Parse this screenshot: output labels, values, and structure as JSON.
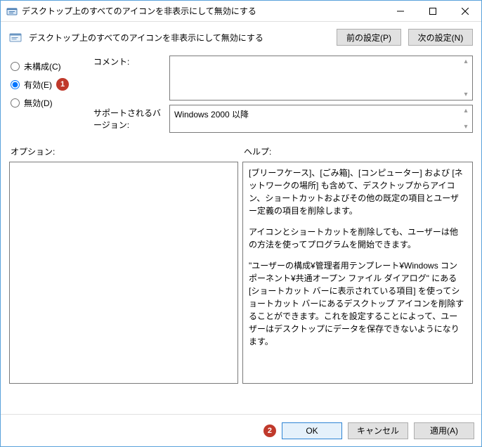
{
  "window": {
    "title": "デスクトップ上のすべてのアイコンを非表示にして無効にする"
  },
  "header": {
    "title": "デスクトップ上のすべてのアイコンを非表示にして無効にする",
    "prev_button": "前の設定(P)",
    "next_button": "次の設定(N)"
  },
  "radios": {
    "not_configured": "未構成(C)",
    "enabled": "有効(E)",
    "disabled": "無効(D)",
    "selected": "enabled"
  },
  "labels": {
    "comment": "コメント:",
    "supported": "サポートされるバージョン:",
    "options": "オプション:",
    "help": "ヘルプ:"
  },
  "fields": {
    "comment_text": "",
    "supported_text": "Windows 2000 以降"
  },
  "help_paragraphs": [
    "[ブリーフケース]、[ごみ箱]、[コンピューター] および [ネットワークの場所] も含めて、デスクトップからアイコン、ショートカットおよびその他の既定の項目とユーザー定義の項目を削除します。",
    "アイコンとショートカットを削除しても、ユーザーは他の方法を使ってプログラムを開始できます。",
    "\"ユーザーの構成¥管理者用テンプレート¥Windows コンポーネント¥共通オープン ファイル ダイアログ\" にある [ショートカット バーに表示されている項目] を使ってショートカット バーにあるデスクトップ アイコンを削除することができます。これを設定することによって、ユーザーはデスクトップにデータを保存できないようになります。"
  ],
  "footer": {
    "ok": "OK",
    "cancel": "キャンセル",
    "apply": "適用(A)"
  },
  "annotations": {
    "badge1": "1",
    "badge2": "2"
  }
}
